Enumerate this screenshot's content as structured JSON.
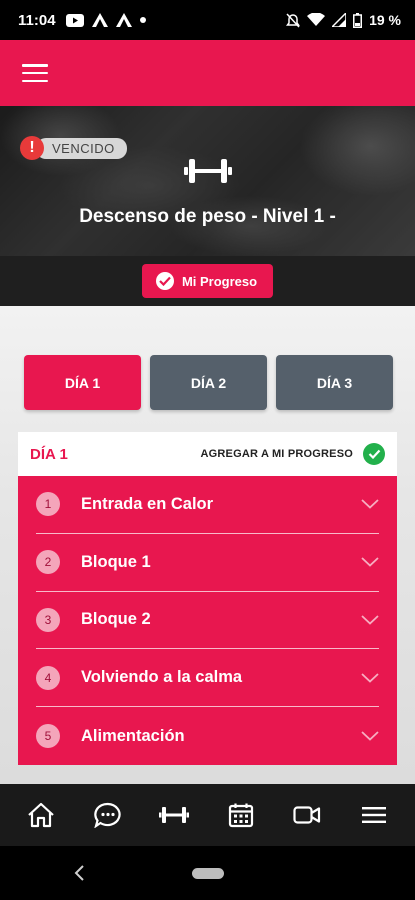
{
  "status_bar": {
    "time": "11:04",
    "battery": "19 %",
    "icons_left": [
      "youtube-icon",
      "app-a-icon",
      "app-a-icon",
      "dot-icon"
    ],
    "icons_right": [
      "mute-icon",
      "wifi-icon",
      "signal-icon",
      "battery-icon"
    ]
  },
  "app_bar": {
    "menu_icon": "hamburger-icon",
    "color": "#e8174f"
  },
  "hero": {
    "badge": "VENCIDO",
    "badge_icon": "!",
    "icon": "dumbbell-icon",
    "title": "Descenso de peso - Nivel 1 -"
  },
  "progress_button": {
    "label": "Mi Progreso",
    "icon": "check-circle-icon"
  },
  "day_tabs": [
    {
      "label": "DÍA 1",
      "active": true
    },
    {
      "label": "DÍA 2",
      "active": false
    },
    {
      "label": "DÍA 3",
      "active": false
    }
  ],
  "day_card": {
    "title": "DÍA 1",
    "add_label": "AGREGAR A MI PROGRESO",
    "add_icon": "green-check-icon",
    "blocks": [
      {
        "num": "1",
        "label": "Entrada en Calor"
      },
      {
        "num": "2",
        "label": "Bloque 1"
      },
      {
        "num": "3",
        "label": "Bloque 2"
      },
      {
        "num": "4",
        "label": "Volviendo a la calma"
      },
      {
        "num": "5",
        "label": "Alimentación"
      }
    ]
  },
  "bottom_nav": [
    "home-icon",
    "chat-icon",
    "dumbbell-icon",
    "calendar-icon",
    "video-icon",
    "menu-icon"
  ],
  "colors": {
    "primary": "#e8174f",
    "tab_inactive": "#55606b",
    "success": "#22b04b"
  }
}
